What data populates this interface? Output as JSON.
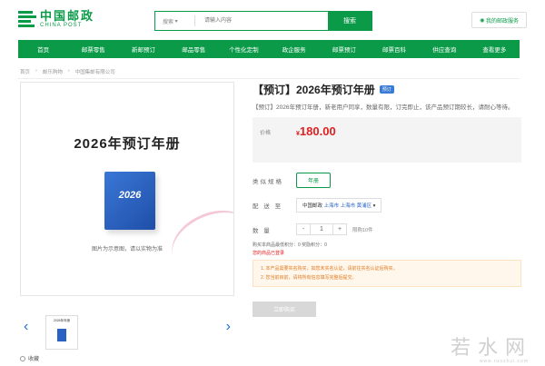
{
  "header": {
    "logo_cn": "中国邮政",
    "logo_en": "CHINA POST",
    "search_select": "搜索",
    "search_placeholder": "请输入内容",
    "search_button": "搜索",
    "top_link": "我的邮政服务"
  },
  "nav": [
    "首页",
    "邮票零售",
    "新邮预订",
    "邮品零售",
    "个性化定制",
    "政企服务",
    "邮票预订",
    "邮票百科",
    "供应查询",
    "查看更多"
  ],
  "breadcrumb": [
    "首页",
    "邮乐购物",
    "中国集邮有限公司"
  ],
  "preview": {
    "title": "2026年预订年册",
    "book_year": "2026",
    "note": "图片为示意图，请以实物为准"
  },
  "thumbs": {
    "title": "2026年年册",
    "prev": "‹",
    "next": "›"
  },
  "favorite": "收藏",
  "product": {
    "title": "【预订】2026年预订年册",
    "tag": "预订",
    "desc": "【预订】2026年预订年册，新老用户同享，数量有限，订完即止，该产品预订期较长，请耐心等待。",
    "price_label": "价格",
    "price_symbol": "¥",
    "price": "180.00",
    "spec_label": "类似规格",
    "spec_value": "年册",
    "ship_label": "配 送 至",
    "ship_prefix": "中国邮政",
    "ship_value": "上海市 上海市 黄浦区",
    "qty_label": "数    量",
    "qty_minus": "-",
    "qty_value": "1",
    "qty_plus": "+",
    "qty_limit": "限购10件",
    "points": "购买本商品最低积分：0    奖励积分：0",
    "login": "您的商品已登录",
    "warn_1": "1. 本产品需要实名购买，如您未实名认证，请前往实名认证后购买。",
    "warn_2": "2. 您当前目前，请将所有信息填写完整后提交。",
    "buy_button": "立即购买"
  },
  "watermark": {
    "text": "若水网",
    "sub": "www.ruoshui.com"
  }
}
